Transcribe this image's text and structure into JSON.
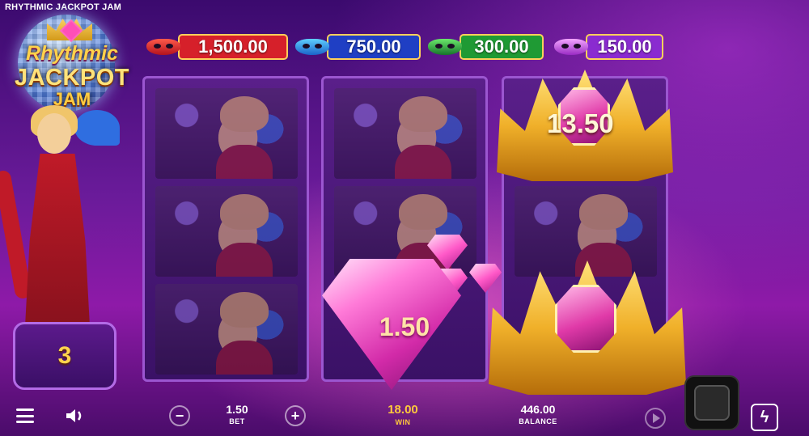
{
  "window": {
    "title": "RHYTHMIC JACKPOT JAM"
  },
  "logo": {
    "line1": "Rhythmic",
    "line2": "JACKPOT",
    "line3": "JAM"
  },
  "jackpots": [
    {
      "icon": "red-mask-icon",
      "value": "1,500.00",
      "color": "#d6202a"
    },
    {
      "icon": "blue-mask-icon",
      "value": "750.00",
      "color": "#1f3fc4"
    },
    {
      "icon": "green-mask-icon",
      "value": "300.00",
      "color": "#1f9a34"
    },
    {
      "icon": "purple-mask-icon",
      "value": "150.00",
      "color": "#8a2bd0"
    }
  ],
  "reels": {
    "crown_top_value": "13.50",
    "diamond_value": "1.50"
  },
  "free_spins_counter": "3",
  "bottom_bar": {
    "bet_value": "1.50",
    "bet_label": "BET",
    "win_value": "18.00",
    "win_label": "WIN",
    "balance_value": "446.00",
    "balance_label": "BALANCE",
    "minus_glyph": "−",
    "plus_glyph": "+",
    "turbo_glyph": "ϟ"
  },
  "colors": {
    "accent_gold": "#ffc93c",
    "background": "#6a1b9a"
  }
}
